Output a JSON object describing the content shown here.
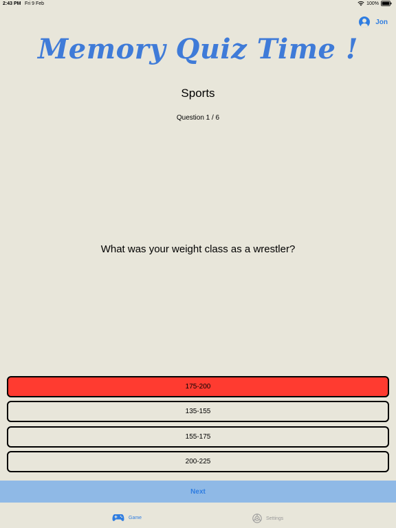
{
  "status_bar": {
    "time": "2:43 PM",
    "date": "Fri 9 Feb",
    "battery": "100%",
    "icons": [
      "wifi-icon",
      "battery-icon"
    ]
  },
  "header": {
    "user_name": "Jon",
    "user_icon": "person-circle-icon",
    "app_title": "Memory Quiz Time !"
  },
  "quiz": {
    "category": "Sports",
    "progress": "Question 1 / 6",
    "question": "What was your weight class as a wrestler?",
    "answers": [
      {
        "label": "175-200",
        "selected": true
      },
      {
        "label": "135-155",
        "selected": false
      },
      {
        "label": "155-175",
        "selected": false
      },
      {
        "label": "200-225",
        "selected": false
      }
    ],
    "next_label": "Next"
  },
  "tab_bar": {
    "tabs": [
      {
        "label": "Game",
        "icon": "gamecontroller-icon",
        "active": true
      },
      {
        "label": "Settings",
        "icon": "gear-icon",
        "active": false
      }
    ]
  },
  "colors": {
    "background": "#e8e6da",
    "accent": "#2f7de1",
    "title": "#3f7bd8",
    "selected_answer": "#ff3b30",
    "next_bar": "#8fb9e6",
    "inactive_tab": "#9a9a9a"
  }
}
